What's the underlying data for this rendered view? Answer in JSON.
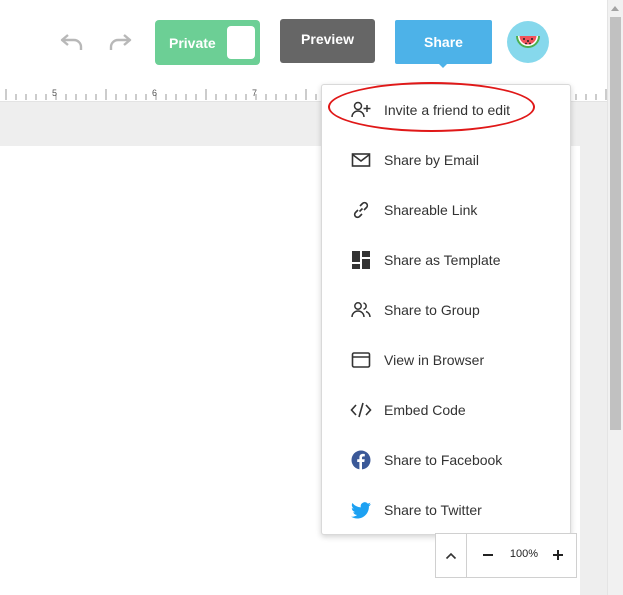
{
  "toolbar": {
    "undo_icon": "undo-icon",
    "redo_icon": "redo-icon",
    "private_label": "Private",
    "preview_label": "Preview",
    "share_label": "Share",
    "avatar_icon": "watermelon-avatar-icon"
  },
  "ruler": {
    "numbers": [
      "5",
      "6",
      "7"
    ]
  },
  "share_menu": {
    "items": [
      {
        "label": "Invite a friend to edit",
        "icon": "add-user-icon"
      },
      {
        "label": "Share by Email",
        "icon": "envelope-icon"
      },
      {
        "label": "Shareable Link",
        "icon": "link-icon"
      },
      {
        "label": "Share as Template",
        "icon": "template-grid-icon"
      },
      {
        "label": "Share to Group",
        "icon": "group-icon"
      },
      {
        "label": "View in Browser",
        "icon": "browser-window-icon"
      },
      {
        "label": "Embed Code",
        "icon": "code-icon"
      },
      {
        "label": "Share to Facebook",
        "icon": "facebook-icon"
      },
      {
        "label": "Share to Twitter",
        "icon": "twitter-icon"
      }
    ]
  },
  "zoom": {
    "level": "100%"
  },
  "colors": {
    "private_green": "#6ccf95",
    "preview_gray": "#666666",
    "share_blue": "#4db2e8",
    "highlight_red": "#e01818",
    "facebook_blue": "#3b5998",
    "twitter_blue": "#1da1f2"
  }
}
